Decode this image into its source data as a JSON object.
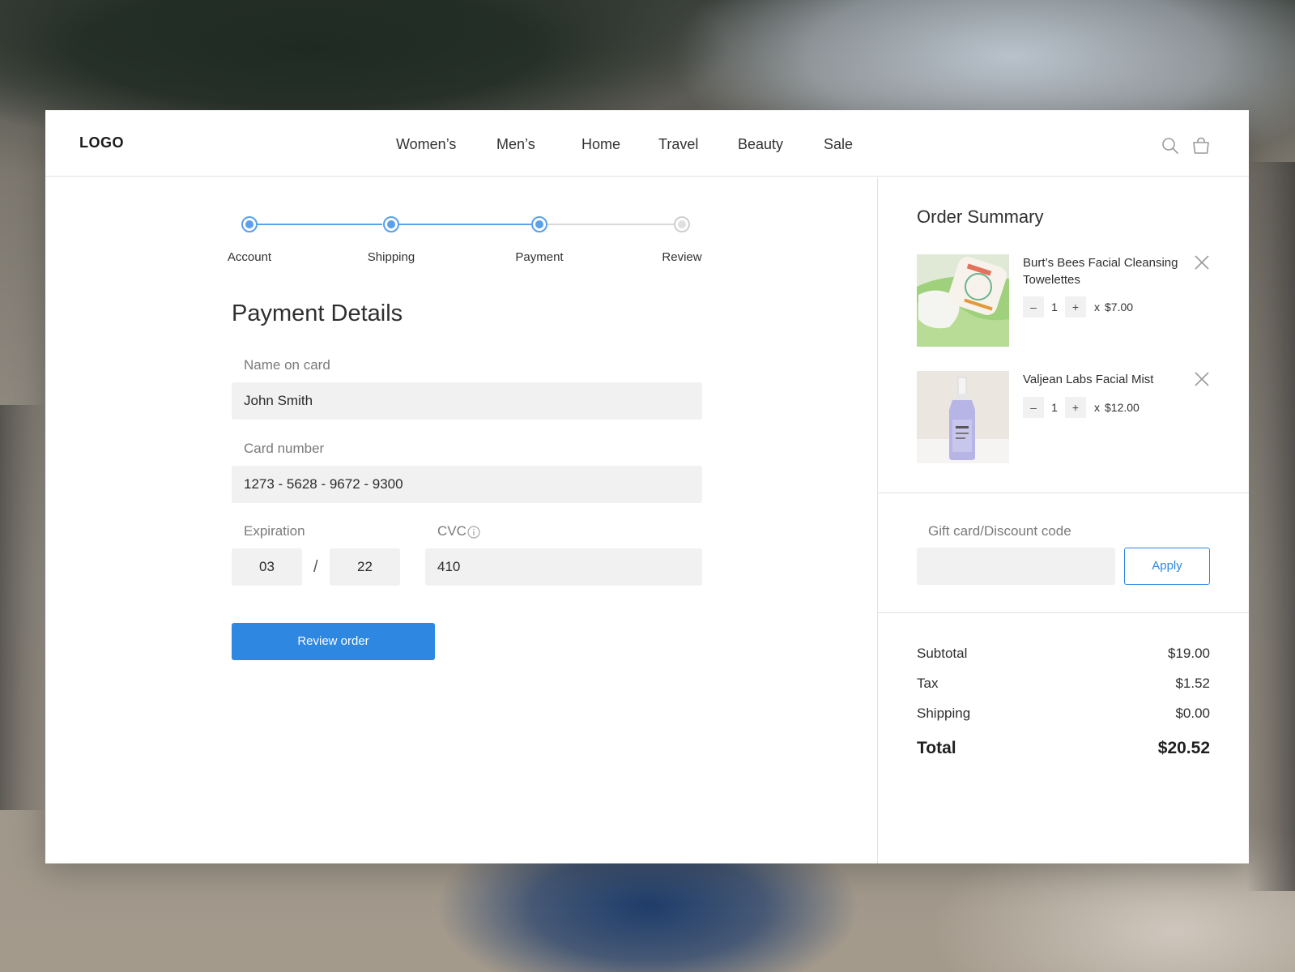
{
  "header": {
    "logo": "LOGO",
    "nav": [
      "Women’s",
      "Men’s",
      "Home",
      "Travel",
      "Beauty",
      "Sale"
    ],
    "icons": [
      "search-icon",
      "shopping-bag-icon"
    ]
  },
  "stepper": {
    "steps": [
      "Account",
      "Shipping",
      "Payment",
      "Review"
    ],
    "current": "Payment"
  },
  "payment": {
    "title": "Payment Details",
    "name_label": "Name on card",
    "name_value": "John Smith",
    "card_label": "Card number",
    "card_value": "1273 - 5628 - 9672 - 9300",
    "expiration_label": "Expiration",
    "exp_month": "03",
    "exp_separator": "/",
    "exp_year": "22",
    "cvc_label": "CVC",
    "cvc_value": "410",
    "submit_label": "Review order"
  },
  "summary": {
    "title": "Order Summary",
    "items": [
      {
        "name": "Burt’s Bees Facial Cleansing Towelettes",
        "qty": "1",
        "price": "$7.00"
      },
      {
        "name": "Valjean Labs Facial Mist",
        "qty": "1",
        "price": "$12.00"
      }
    ],
    "qty_minus": "–",
    "qty_plus": "+",
    "times": "x",
    "discount_label": "Gift card/Discount code",
    "apply_label": "Apply",
    "subtotal_label": "Subtotal",
    "subtotal_value": "$19.00",
    "tax_label": "Tax",
    "tax_value": "$1.52",
    "shipping_label": "Shipping",
    "shipping_value": "$0.00",
    "total_label": "Total",
    "total_value": "$20.52"
  },
  "colors": {
    "accent": "#2e87e0",
    "step_active": "#5aa0ea",
    "field_bg": "#f1f1f1"
  }
}
